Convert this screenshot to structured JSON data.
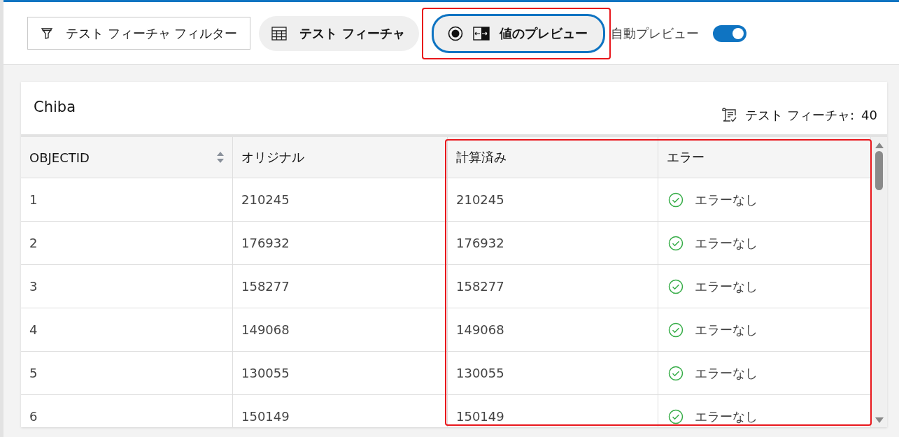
{
  "toolbar": {
    "filter_button": {
      "label": "テスト フィーチャ フィルター"
    },
    "features_button": {
      "label": "テスト フィーチャ"
    },
    "preview_button": {
      "label": "値のプレビュー",
      "selected": true
    },
    "auto_preview": {
      "label": "自動プレビュー",
      "on": true
    }
  },
  "panel": {
    "title": "Chiba",
    "count_label": "テスト フィーチャ:",
    "count": "40",
    "table": {
      "columns": [
        {
          "label": "OBJECTID",
          "sortable": true
        },
        {
          "label": "オリジナル",
          "sortable": false
        },
        {
          "label": "計算済み",
          "sortable": false
        },
        {
          "label": "エラー",
          "sortable": false
        }
      ],
      "rows": [
        {
          "objectid": "1",
          "original": "210245",
          "calculated": "210245",
          "kind": "ok",
          "error": "エラーなし"
        },
        {
          "objectid": "2",
          "original": "176932",
          "calculated": "176932",
          "kind": "ok",
          "error": "エラーなし"
        },
        {
          "objectid": "3",
          "original": "158277",
          "calculated": "158277",
          "kind": "ok",
          "error": "エラーなし"
        },
        {
          "objectid": "4",
          "original": "149068",
          "calculated": "149068",
          "kind": "ok",
          "error": "エラーなし"
        },
        {
          "objectid": "5",
          "original": "130055",
          "calculated": "130055",
          "kind": "ok",
          "error": "エラーなし"
        },
        {
          "objectid": "6",
          "original": "150149",
          "calculated": "150149",
          "kind": "ok",
          "error": "エラーなし"
        }
      ]
    }
  }
}
